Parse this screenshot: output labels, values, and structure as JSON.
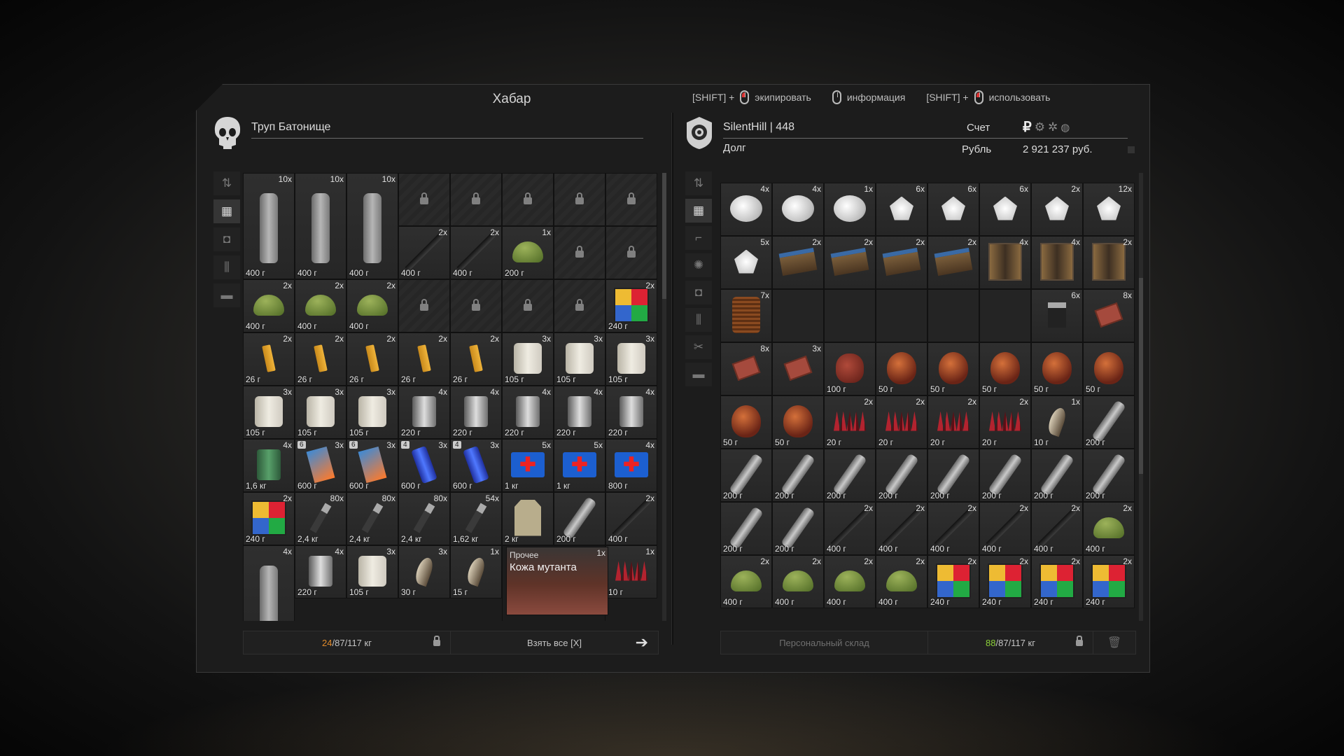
{
  "window": {
    "title": "Хабар"
  },
  "hints": [
    {
      "prefix": "[SHIFT] +",
      "action": "экипировать",
      "mouse": "left"
    },
    {
      "prefix": "",
      "action": "информация",
      "mouse": "plain"
    },
    {
      "prefix": "[SHIFT] +",
      "action": "использовать",
      "mouse": "right"
    }
  ],
  "left": {
    "name": "Труп Батонище",
    "weight_current": "24",
    "weight_rest": "/87/117 кг",
    "take_all": "Взять все [X]"
  },
  "right": {
    "name": "SilentHill | 448",
    "account_label": "Счет",
    "currency_symbol": "₽",
    "debt_label": "Долг",
    "currency_label": "Рубль",
    "balance": "2 921 237 руб.",
    "stash_label": "Персональный склад",
    "weight_current": "88",
    "weight_rest": "/87/117 кг"
  },
  "tooltip": {
    "category": "Прочее",
    "name": "Кожа мутанта",
    "count": "1x"
  },
  "left_items": [
    {
      "icon": "bottle",
      "count": "10x",
      "weight": "400 г"
    },
    {
      "icon": "bottle",
      "count": "10x",
      "weight": "400 г"
    },
    {
      "icon": "bottle",
      "count": "10x",
      "weight": "400 г"
    },
    {
      "icon": "locked"
    },
    {
      "icon": "locked"
    },
    {
      "icon": "locked"
    },
    {
      "icon": "locked"
    },
    {
      "icon": "locked"
    },
    {
      "icon": "bottle-cont"
    },
    {
      "icon": "bottle-cont"
    },
    {
      "icon": "bottle-cont"
    },
    {
      "icon": "knife",
      "count": "2x",
      "weight": "400 г"
    },
    {
      "icon": "knife",
      "count": "2x",
      "weight": "400 г"
    },
    {
      "icon": "mine",
      "count": "1x",
      "weight": "200 г"
    },
    {
      "icon": "locked"
    },
    {
      "icon": "locked"
    },
    {
      "icon": "mine",
      "count": "2x",
      "weight": "400 г"
    },
    {
      "icon": "mine",
      "count": "2x",
      "weight": "400 г"
    },
    {
      "icon": "mine",
      "count": "2x",
      "weight": "400 г"
    },
    {
      "icon": "locked"
    },
    {
      "icon": "locked"
    },
    {
      "icon": "locked"
    },
    {
      "icon": "locked"
    },
    {
      "icon": "rubik",
      "count": "2x",
      "weight": "240 г"
    },
    {
      "icon": "lighter",
      "count": "2x",
      "weight": "26 г"
    },
    {
      "icon": "lighter",
      "count": "2x",
      "weight": "26 г"
    },
    {
      "icon": "lighter",
      "count": "2x",
      "weight": "26 г"
    },
    {
      "icon": "lighter",
      "count": "2x",
      "weight": "26 г"
    },
    {
      "icon": "lighter",
      "count": "2x",
      "weight": "26 г"
    },
    {
      "icon": "roll",
      "count": "3x",
      "weight": "105 г"
    },
    {
      "icon": "roll",
      "count": "3x",
      "weight": "105 г"
    },
    {
      "icon": "roll",
      "count": "3x",
      "weight": "105 г"
    },
    {
      "icon": "roll",
      "count": "3x",
      "weight": "105 г"
    },
    {
      "icon": "roll",
      "count": "3x",
      "weight": "105 г"
    },
    {
      "icon": "roll",
      "count": "3x",
      "weight": "105 г"
    },
    {
      "icon": "can",
      "count": "4x",
      "weight": "220 г"
    },
    {
      "icon": "can",
      "count": "4x",
      "weight": "220 г"
    },
    {
      "icon": "can",
      "count": "4x",
      "weight": "220 г"
    },
    {
      "icon": "can",
      "count": "4x",
      "weight": "220 г"
    },
    {
      "icon": "can",
      "count": "4x",
      "weight": "220 г"
    },
    {
      "icon": "tin",
      "count": "4x",
      "weight": "1,6 кг"
    },
    {
      "icon": "bars",
      "count": "3x",
      "weight": "600 г",
      "cond": "6"
    },
    {
      "icon": "bars",
      "count": "3x",
      "weight": "600 г",
      "cond": "6"
    },
    {
      "icon": "battery",
      "count": "3x",
      "weight": "600 г",
      "cond": "4"
    },
    {
      "icon": "battery",
      "count": "3x",
      "weight": "600 г",
      "cond": "4"
    },
    {
      "icon": "medkit",
      "count": "5x",
      "weight": "1 кг"
    },
    {
      "icon": "medkit",
      "count": "5x",
      "weight": "1 кг"
    },
    {
      "icon": "medkit",
      "count": "4x",
      "weight": "800 г"
    },
    {
      "icon": "rubik",
      "count": "2x",
      "weight": "240 г"
    },
    {
      "icon": "shell",
      "count": "80x",
      "weight": "2,4 кг"
    },
    {
      "icon": "shell",
      "count": "80x",
      "weight": "2,4 кг"
    },
    {
      "icon": "shell",
      "count": "80x",
      "weight": "2,4 кг"
    },
    {
      "icon": "shell",
      "count": "54x",
      "weight": "1,62 кг"
    },
    {
      "icon": "vest",
      "count": "",
      "weight": "2 кг"
    },
    {
      "icon": "multitool",
      "count": "",
      "weight": "200 г"
    },
    {
      "icon": "knife",
      "count": "2x",
      "weight": "400 г"
    },
    {
      "icon": "bottle",
      "count": "4x",
      "weight": ""
    },
    {
      "icon": "can",
      "count": "4x",
      "weight": "220 г"
    },
    {
      "icon": "roll",
      "count": "3x",
      "weight": "105 г"
    },
    {
      "icon": "claw",
      "count": "3x",
      "weight": "30 г"
    },
    {
      "icon": "claw",
      "count": "1x",
      "weight": "15 г"
    },
    {
      "icon": "tooltip"
    },
    {
      "icon": "tooltip-cont"
    },
    {
      "icon": "spikes",
      "count": "1x",
      "weight": "10 г"
    }
  ],
  "right_items": [
    {
      "icon": "cotton",
      "count": "4x",
      "weight": ""
    },
    {
      "icon": "cotton",
      "count": "4x",
      "weight": ""
    },
    {
      "icon": "cotton",
      "count": "1x",
      "weight": ""
    },
    {
      "icon": "shard",
      "count": "6x",
      "weight": ""
    },
    {
      "icon": "shard",
      "count": "6x",
      "weight": ""
    },
    {
      "icon": "shard",
      "count": "6x",
      "weight": ""
    },
    {
      "icon": "shard",
      "count": "2x",
      "weight": ""
    },
    {
      "icon": "shard",
      "count": "12x",
      "weight": ""
    },
    {
      "icon": "shard",
      "count": "5x",
      "weight": ""
    },
    {
      "icon": "device",
      "count": "2x",
      "weight": ""
    },
    {
      "icon": "device",
      "count": "2x",
      "weight": ""
    },
    {
      "icon": "device",
      "count": "2x",
      "weight": ""
    },
    {
      "icon": "device",
      "count": "2x",
      "weight": ""
    },
    {
      "icon": "transformer",
      "count": "4x",
      "weight": ""
    },
    {
      "icon": "transformer",
      "count": "4x",
      "weight": ""
    },
    {
      "icon": "transformer",
      "count": "2x",
      "weight": ""
    },
    {
      "icon": "coil",
      "count": "7x",
      "weight": ""
    },
    {
      "icon": "empty"
    },
    {
      "icon": "empty"
    },
    {
      "icon": "empty"
    },
    {
      "icon": "empty"
    },
    {
      "icon": "empty"
    },
    {
      "icon": "transistor",
      "count": "6x",
      "weight": ""
    },
    {
      "icon": "chip",
      "count": "8x",
      "weight": ""
    },
    {
      "icon": "chip",
      "count": "8x",
      "weight": ""
    },
    {
      "icon": "chip",
      "count": "3x",
      "weight": ""
    },
    {
      "icon": "heart",
      "count": "",
      "weight": "100 г"
    },
    {
      "icon": "organ",
      "count": "",
      "weight": "50 г"
    },
    {
      "icon": "organ",
      "count": "",
      "weight": "50 г"
    },
    {
      "icon": "organ",
      "count": "",
      "weight": "50 г"
    },
    {
      "icon": "organ",
      "count": "",
      "weight": "50 г"
    },
    {
      "icon": "organ",
      "count": "",
      "weight": "50 г"
    },
    {
      "icon": "organ",
      "count": "",
      "weight": "50 г"
    },
    {
      "icon": "organ",
      "count": "",
      "weight": "50 г"
    },
    {
      "icon": "spikes",
      "count": "2x",
      "weight": "20 г"
    },
    {
      "icon": "spikes",
      "count": "2x",
      "weight": "20 г"
    },
    {
      "icon": "spikes",
      "count": "2x",
      "weight": "20 г"
    },
    {
      "icon": "spikes",
      "count": "2x",
      "weight": "20 г"
    },
    {
      "icon": "claw",
      "count": "1x",
      "weight": "10 г"
    },
    {
      "icon": "multitool",
      "count": "",
      "weight": "200 г"
    },
    {
      "icon": "multitool",
      "count": "",
      "weight": "200 г"
    },
    {
      "icon": "multitool",
      "count": "",
      "weight": "200 г"
    },
    {
      "icon": "multitool",
      "count": "",
      "weight": "200 г"
    },
    {
      "icon": "multitool",
      "count": "",
      "weight": "200 г"
    },
    {
      "icon": "multitool",
      "count": "",
      "weight": "200 г"
    },
    {
      "icon": "multitool",
      "count": "",
      "weight": "200 г"
    },
    {
      "icon": "multitool",
      "count": "",
      "weight": "200 г"
    },
    {
      "icon": "multitool",
      "count": "",
      "weight": "200 г"
    },
    {
      "icon": "multitool",
      "count": "",
      "weight": "200 г"
    },
    {
      "icon": "multitool",
      "count": "",
      "weight": "200 г"
    },
    {
      "icon": "knife",
      "count": "2x",
      "weight": "400 г"
    },
    {
      "icon": "knife",
      "count": "2x",
      "weight": "400 г"
    },
    {
      "icon": "knife",
      "count": "2x",
      "weight": "400 г"
    },
    {
      "icon": "knife",
      "count": "2x",
      "weight": "400 г"
    },
    {
      "icon": "knife",
      "count": "2x",
      "weight": "400 г"
    },
    {
      "icon": "mine",
      "count": "2x",
      "weight": "400 г"
    },
    {
      "icon": "mine",
      "count": "2x",
      "weight": "400 г"
    },
    {
      "icon": "mine",
      "count": "2x",
      "weight": "400 г"
    },
    {
      "icon": "mine",
      "count": "2x",
      "weight": "400 г"
    },
    {
      "icon": "mine",
      "count": "2x",
      "weight": "400 г"
    },
    {
      "icon": "rubik",
      "count": "2x",
      "weight": "240 г"
    },
    {
      "icon": "rubik",
      "count": "2x",
      "weight": "240 г"
    },
    {
      "icon": "rubik",
      "count": "2x",
      "weight": "240 г"
    },
    {
      "icon": "rubik",
      "count": "2x",
      "weight": "240 г"
    }
  ],
  "colors": {
    "weight_left": "#e08a2b",
    "weight_right": "#8ccf3a"
  }
}
